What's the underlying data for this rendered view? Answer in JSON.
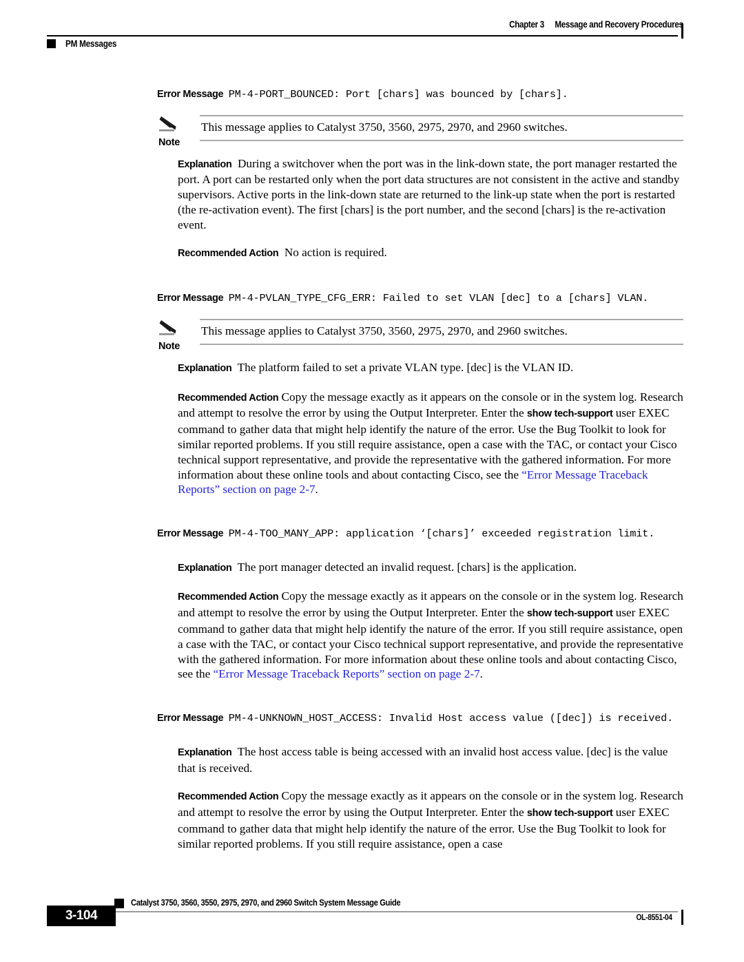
{
  "header": {
    "left_label": "PM Messages",
    "chapter": "Chapter 3",
    "chapter_title": "Message and Recovery Procedures"
  },
  "footer": {
    "page_number": "3-104",
    "guide_title": "Catalyst 3750, 3560, 3550, 2975, 2970, and 2960 Switch System Message Guide",
    "doc_id": "OL-8551-04"
  },
  "labels": {
    "error_message": "Error Message",
    "explanation": "Explanation",
    "recommended_action": "Recommended Action",
    "note": "Note"
  },
  "colors": {
    "link": "#2424dd",
    "rule_gray": "#a9a9a9",
    "text": "#000000"
  },
  "blocks": [
    {
      "id": "pm-4-port-bounced",
      "message": "PM-4-PORT_BOUNCED: Port [chars] was bounced by [chars].",
      "note": "This message applies to Catalyst 3750, 3560, 2975, 2970, and 2960 switches.",
      "explanation": "During a switchover when the port was in the link-down state, the port manager restarted the port. A port can be restarted only when the port data structures are not consistent in the active and standby supervisors. Active ports in the link-down state are returned to the link-up state when the port is restarted (the re-activation event). The first [chars] is the port number, and the second [chars] is the re-activation event.",
      "recommended_action": "No action is required."
    },
    {
      "id": "pm-4-pvlan-type-cfg-err",
      "message": "PM-4-PVLAN_TYPE_CFG_ERR: Failed to set VLAN [dec] to a [chars] VLAN.",
      "note": "This message applies to Catalyst 3750, 3560, 2975, 2970, and 2960 switches.",
      "explanation": "The platform failed to set a private VLAN type. [dec] is the VLAN ID.",
      "ra_part1": "Copy the message exactly as it appears on the console or in the system log. Research and attempt to resolve the error by using the Output Interpreter. Enter the ",
      "ra_cmd1": "show tech-support",
      "ra_part2": " user EXEC command to gather data that might help identify the nature of the error. Use the Bug Toolkit to look for similar reported problems. If you still require assistance, open a case with the TAC, or contact your Cisco technical support representative, and provide the representative with the gathered information. For more information about these online tools and about contacting Cisco, see the ",
      "ra_link": "“Error Message Traceback Reports” section on page 2-7",
      "ra_part3": "."
    },
    {
      "id": "pm-4-too-many-app",
      "message": "PM-4-TOO_MANY_APP: application ‘[chars]’ exceeded registration limit.",
      "explanation": "The port manager detected an invalid request. [chars] is the application.",
      "ra_part1": "Copy the message exactly as it appears on the console or in the system log. Research and attempt to resolve the error by using the Output Interpreter. Enter the ",
      "ra_cmd1": "show tech-support",
      "ra_part2": " user EXEC command to gather data that might help identify the nature of the error. If you still require assistance, open a case with the TAC, or contact your Cisco technical support representative, and provide the representative with the gathered information. For more information about these online tools and about contacting Cisco, see the ",
      "ra_link": "“Error Message Traceback Reports” section on page 2-7",
      "ra_part3": "."
    },
    {
      "id": "pm-4-unknown-host-access",
      "message": "PM-4-UNKNOWN_HOST_ACCESS: Invalid Host access value ([dec]) is received.",
      "explanation": "The host access table is being accessed with an invalid host access value. [dec] is the value that is received.",
      "ra_part1": "Copy the message exactly as it appears on the console or in the system log. Research and attempt to resolve the error by using the Output Interpreter. Enter the ",
      "ra_cmd1": "show tech-support",
      "ra_part2": " user EXEC command to gather data that might help identify the nature of the error. Use the Bug Toolkit to look for similar reported problems. If you still require assistance, open a case"
    }
  ]
}
